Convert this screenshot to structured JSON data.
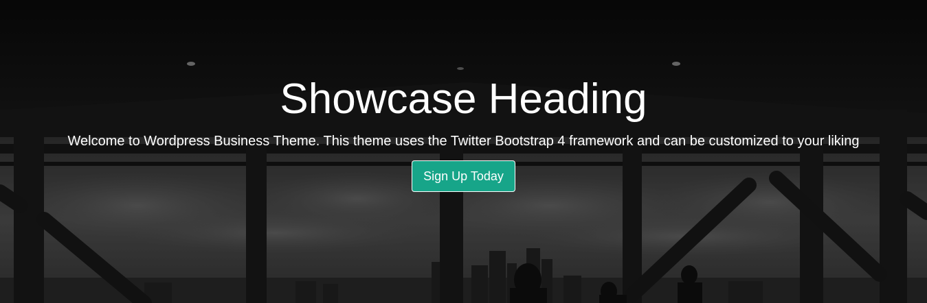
{
  "showcase": {
    "heading": "Showcase Heading",
    "subtitle": "Welcome to Wordpress Business Theme. This theme uses the Twitter Bootstrap 4 framework and can be customized to your liking",
    "cta_label": "Sign Up Today"
  },
  "colors": {
    "cta_background": "#17a589",
    "text": "#ffffff",
    "overlay": "#0d0d0d"
  }
}
